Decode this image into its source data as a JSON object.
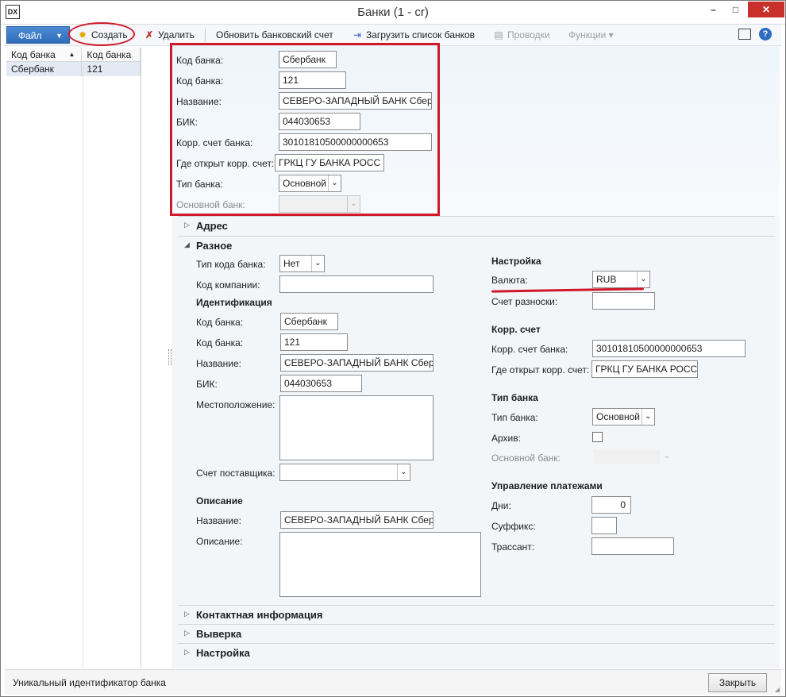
{
  "window": {
    "title": "Банки (1 - cr)",
    "app_icon": "DX",
    "min": "–",
    "max": "□",
    "close": "✕"
  },
  "toolbar": {
    "file": "Файл",
    "create": "Создать",
    "delete": "Удалить",
    "update_account": "Обновить банковский счет",
    "load_banks": "Загрузить список банков",
    "postings": "Проводки",
    "functions": "Функции"
  },
  "grid": {
    "headers": [
      "Код банка",
      "Код банка"
    ],
    "rows": [
      [
        "Сбербанк",
        "121"
      ]
    ]
  },
  "header_form": {
    "bank_code_label": "Код банка:",
    "bank_code": "Сбербанк",
    "bank_code2_label": "Код банка:",
    "bank_code2": "121",
    "name_label": "Название:",
    "name": "СЕВЕРО-ЗАПАДНЫЙ БАНК Сберб",
    "bik_label": "БИК:",
    "bik": "044030653",
    "corr_label": "Корр. счет банка:",
    "corr": "30101810500000000653",
    "corr_where_label": "Где открыт корр. счет:",
    "corr_where": "ГРКЦ ГУ БАНКА РОСС",
    "bank_type_label": "Тип банка:",
    "bank_type": "Основной",
    "main_bank_label": "Основной банк:",
    "main_bank": ""
  },
  "sections": {
    "address": "Адрес",
    "misc": "Разное",
    "contact": "Контактная информация",
    "reconciliation": "Выверка",
    "settings": "Настройка"
  },
  "misc": {
    "code_type_label": "Тип кода банка:",
    "code_type": "Нет",
    "company_label": "Код компании:",
    "company": "",
    "ident_title": "Идентификация",
    "bank_code_label": "Код банка:",
    "bank_code": "Сбербанк",
    "bank_code2_label": "Код банка:",
    "bank_code2": "121",
    "name_label": "Название:",
    "name": "СЕВЕРО-ЗАПАДНЫЙ БАНК Сберб",
    "bik_label": "БИК:",
    "bik": "044030653",
    "location_label": "Местоположение:",
    "location": "",
    "vendor_label": "Счет поставщика:",
    "vendor": "",
    "desc_title": "Описание",
    "desc_name_label": "Название:",
    "desc_name": "СЕВЕРО-ЗАПАДНЫЙ БАНК Сберб",
    "desc_label": "Описание:",
    "desc": ""
  },
  "setup": {
    "title": "Настройка",
    "currency_label": "Валюта:",
    "currency": "RUB",
    "posting_label": "Счет разноски:",
    "posting": "",
    "corr_title": "Корр. счет",
    "corr_label": "Корр. счет банка:",
    "corr": "30101810500000000653",
    "corr_where_label": "Где открыт корр. счет:",
    "corr_where": "ГРКЦ ГУ БАНКА РОСС",
    "type_title": "Тип банка",
    "type_label": "Тип банка:",
    "type": "Основной",
    "archive_label": "Архив:",
    "main_bank_label": "Основной банк:",
    "pay_title": "Управление платежами",
    "days_label": "Дни:",
    "days": "0",
    "suffix_label": "Суффикс:",
    "suffix": "",
    "drawer_label": "Трассант:",
    "drawer": ""
  },
  "status": {
    "text": "Уникальный идентификатор банка",
    "close": "Закрыть"
  },
  "colors": {
    "accent": "#2f6dba",
    "highlight": "#d0182a"
  }
}
